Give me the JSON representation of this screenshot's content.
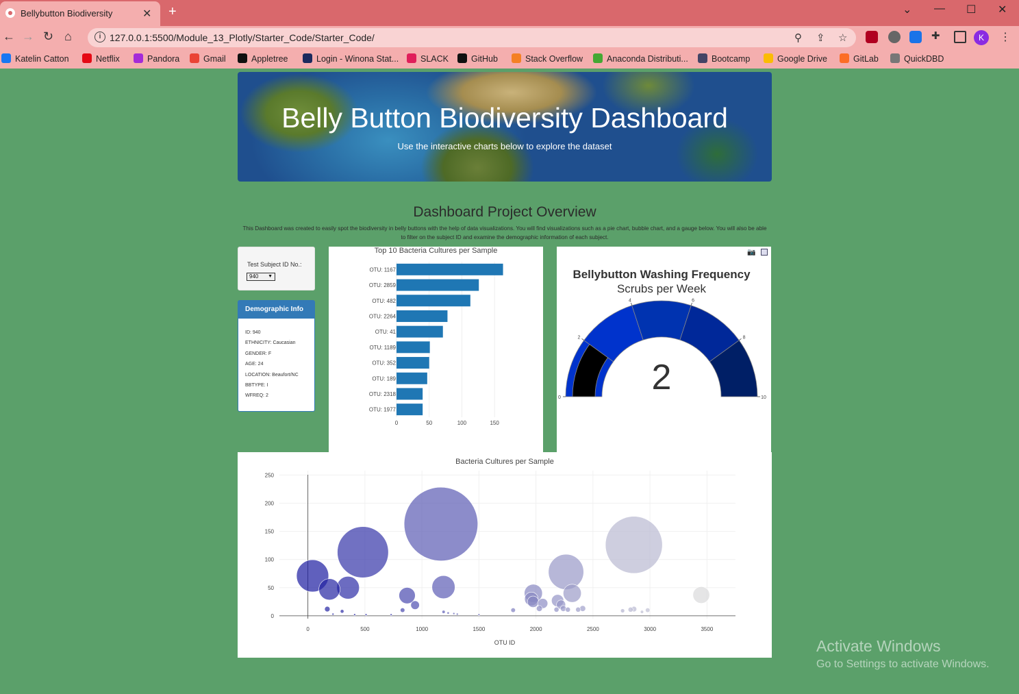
{
  "browser": {
    "tab_title": "Bellybutton Biodiversity",
    "url": "127.0.0.1:5500/Module_13_Plotly/Starter_Code/Starter_Code/",
    "profile_initial": "K",
    "bookmarks": [
      {
        "label": "Katelin Catton",
        "color": "#1877f2"
      },
      {
        "label": "Netflix",
        "color": "#e50914"
      },
      {
        "label": "Pandora",
        "color": "#a42bd8"
      },
      {
        "label": "Gmail",
        "color": "#ea4335"
      },
      {
        "label": "Appletree",
        "color": "#111111"
      },
      {
        "label": "Login - Winona Stat...",
        "color": "#1b2a5e"
      },
      {
        "label": "SLACK",
        "color": "#e01e5a"
      },
      {
        "label": "GitHub",
        "color": "#111111"
      },
      {
        "label": "Stack Overflow",
        "color": "#f48024"
      },
      {
        "label": "Anaconda Distributi...",
        "color": "#44a833"
      },
      {
        "label": "Bootcamp",
        "color": "#444466"
      },
      {
        "label": "Google Drive",
        "color": "#fbbc04"
      },
      {
        "label": "GitLab",
        "color": "#fc6d26"
      },
      {
        "label": "QuickDBD",
        "color": "#777777"
      }
    ]
  },
  "page": {
    "title": "Belly Button Biodiversity Dashboard",
    "subtitle": "Use the interactive charts below to explore the dataset",
    "overview_title": "Dashboard Project Overview",
    "overview_text": "This Dashboard was created to easily spot the biodiversity in belly buttons with the help of data visualizations. You will find visualizations such as a pie chart, bubble chart, and a gauge below. You will also be able to filter on the subject ID and examine the demographic information of each subject."
  },
  "selector": {
    "label": "Test Subject ID No.:",
    "selected": "940"
  },
  "demographic": {
    "title": "Demographic Info",
    "rows": [
      "ID: 940",
      "ETHNICITY: Caucasian",
      "GENDER: F",
      "AGE: 24",
      "LOCATION: Beaufort/NC",
      "BBTYPE: I",
      "WFREQ: 2"
    ]
  },
  "overlay": {
    "line1": "Activate Windows",
    "line2": "Go to Settings to activate Windows."
  },
  "chart_data": [
    {
      "type": "bar",
      "orientation": "horizontal",
      "title": "Top 10 Bacteria Cultures per Sample",
      "categories": [
        "OTU: 1167",
        "OTU: 2859",
        "OTU: 482",
        "OTU: 2264",
        "OTU: 41",
        "OTU: 1189",
        "OTU: 352",
        "OTU: 189",
        "OTU: 2318",
        "OTU: 1977"
      ],
      "values": [
        163,
        126,
        113,
        78,
        71,
        51,
        50,
        47,
        40,
        40
      ],
      "xlim": [
        0,
        175
      ],
      "xticks": [
        0,
        50,
        100,
        150
      ],
      "color": "#1f77b4"
    },
    {
      "type": "gauge",
      "title": "Bellybutton Washing Frequency",
      "subtitle": "Scrubs per Week",
      "value": 2,
      "range": [
        0,
        10
      ],
      "ticks": [
        0,
        2,
        4,
        6,
        8,
        10
      ],
      "bands": [
        {
          "from": 0,
          "to": 2,
          "color": "#0033cc"
        },
        {
          "from": 2,
          "to": 4,
          "color": "#0033cc"
        },
        {
          "from": 4,
          "to": 6,
          "color": "#0033b0"
        },
        {
          "from": 6,
          "to": 8,
          "color": "#002899"
        },
        {
          "from": 8,
          "to": 10,
          "color": "#001f66"
        }
      ],
      "bar_color": "#000000"
    },
    {
      "type": "scatter",
      "title": "Bacteria Cultures per Sample",
      "xlabel": "OTU ID",
      "ylabel": "",
      "xlim": [
        -250,
        3750
      ],
      "ylim": [
        -5,
        270
      ],
      "xticks": [
        0,
        500,
        1000,
        1500,
        2000,
        2500,
        3000,
        3500
      ],
      "yticks": [
        0,
        50,
        100,
        150,
        200,
        250
      ],
      "color_low": "#1a1aa0",
      "color_high": "#dddddd",
      "points": [
        {
          "x": 41,
          "y": 71
        },
        {
          "x": 189,
          "y": 47
        },
        {
          "x": 352,
          "y": 50
        },
        {
          "x": 482,
          "y": 113
        },
        {
          "x": 1167,
          "y": 163
        },
        {
          "x": 1189,
          "y": 51
        },
        {
          "x": 2264,
          "y": 78
        },
        {
          "x": 2859,
          "y": 126
        },
        {
          "x": 1977,
          "y": 40
        },
        {
          "x": 2318,
          "y": 40
        },
        {
          "x": 870,
          "y": 36
        },
        {
          "x": 940,
          "y": 19
        },
        {
          "x": 1960,
          "y": 30
        },
        {
          "x": 1975,
          "y": 25
        },
        {
          "x": 2060,
          "y": 22
        },
        {
          "x": 2190,
          "y": 27
        },
        {
          "x": 2220,
          "y": 20
        },
        {
          "x": 3450,
          "y": 37
        },
        {
          "x": 2410,
          "y": 13
        },
        {
          "x": 2030,
          "y": 13
        },
        {
          "x": 2240,
          "y": 13
        },
        {
          "x": 2370,
          "y": 11
        },
        {
          "x": 1800,
          "y": 10
        },
        {
          "x": 2180,
          "y": 11
        },
        {
          "x": 2280,
          "y": 11
        },
        {
          "x": 2860,
          "y": 12
        },
        {
          "x": 2830,
          "y": 11
        },
        {
          "x": 2760,
          "y": 9
        },
        {
          "x": 2980,
          "y": 10
        },
        {
          "x": 2930,
          "y": 7
        },
        {
          "x": 170,
          "y": 12
        },
        {
          "x": 830,
          "y": 10
        },
        {
          "x": 300,
          "y": 8
        },
        {
          "x": 1190,
          "y": 7
        },
        {
          "x": 1230,
          "y": 5
        },
        {
          "x": 1280,
          "y": 4
        },
        {
          "x": 1310,
          "y": 3
        },
        {
          "x": 220,
          "y": 3
        },
        {
          "x": 410,
          "y": 2
        },
        {
          "x": 510,
          "y": 2
        },
        {
          "x": 730,
          "y": 2
        },
        {
          "x": 1500,
          "y": 2
        }
      ]
    }
  ]
}
